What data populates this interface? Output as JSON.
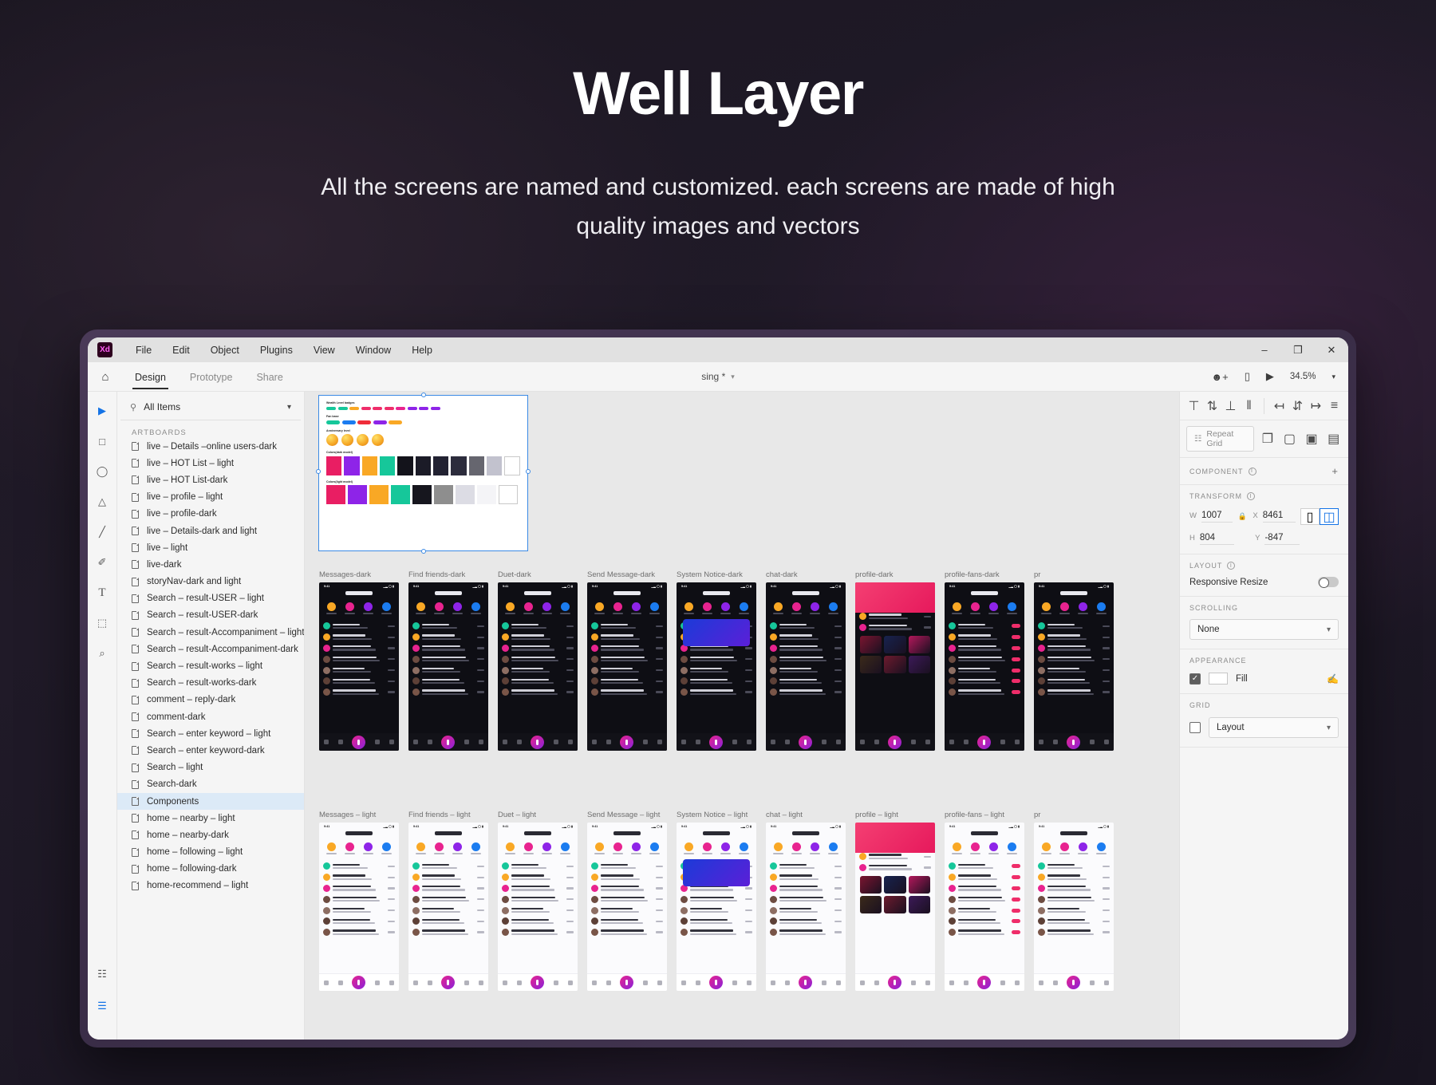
{
  "hero": {
    "title": "Well Layer",
    "subtitle": "All the screens are named and customized. each screens are made of high quality  images and vectors"
  },
  "app": {
    "logo": "Xd",
    "menu": [
      "File",
      "Edit",
      "Object",
      "Plugins",
      "View",
      "Window",
      "Help"
    ],
    "window_controls": [
      "minimize-icon",
      "maximize-icon",
      "close-icon"
    ],
    "tabs": [
      {
        "label": "Design",
        "active": true
      },
      {
        "label": "Prototype",
        "active": false
      },
      {
        "label": "Share",
        "active": false
      }
    ],
    "document_title": "sing *",
    "zoom": "34.5%",
    "toolbar_right_icons": [
      "invite-user-icon",
      "device-preview-icon",
      "play-icon"
    ],
    "home_icon": "home-icon"
  },
  "tools": [
    {
      "name": "select-tool",
      "glyph": "▶",
      "selected": true
    },
    {
      "name": "rectangle-tool",
      "glyph": "□",
      "selected": false
    },
    {
      "name": "ellipse-tool",
      "glyph": "◯",
      "selected": false
    },
    {
      "name": "polygon-tool",
      "glyph": "△",
      "selected": false
    },
    {
      "name": "line-tool",
      "glyph": "╱",
      "selected": false
    },
    {
      "name": "pen-tool",
      "glyph": "✐",
      "selected": false
    },
    {
      "name": "text-tool",
      "glyph": "T",
      "selected": false
    },
    {
      "name": "artboard-tool",
      "glyph": "⬚",
      "selected": false
    },
    {
      "name": "zoom-tool",
      "glyph": "⚲",
      "selected": false
    }
  ],
  "tools_bottom": [
    {
      "name": "assets-panel-icon",
      "glyph": "❐"
    },
    {
      "name": "layers-panel-icon",
      "glyph": "≣"
    }
  ],
  "layers_panel": {
    "search_label": "All Items",
    "search_icon": "search-icon",
    "chevron_icon": "chevron-down-icon",
    "section_title": "ARTBOARDS",
    "items": [
      {
        "label": "live – Details –online users-dark",
        "selected": false
      },
      {
        "label": "live – HOT List – light",
        "selected": false
      },
      {
        "label": "live – HOT List-dark",
        "selected": false
      },
      {
        "label": "live – profile  – light",
        "selected": false
      },
      {
        "label": "live – profile-dark",
        "selected": false
      },
      {
        "label": "live – Details-dark and light",
        "selected": false
      },
      {
        "label": "live – light",
        "selected": false
      },
      {
        "label": "live-dark",
        "selected": false
      },
      {
        "label": "storyNav-dark and light",
        "selected": false
      },
      {
        "label": "Search – result-USER – light",
        "selected": false
      },
      {
        "label": "Search – result-USER-dark",
        "selected": false
      },
      {
        "label": "Search – result-Accompaniment – light",
        "selected": false
      },
      {
        "label": "Search – result-Accompaniment-dark",
        "selected": false
      },
      {
        "label": "Search – result-works  – light",
        "selected": false
      },
      {
        "label": "Search – result-works-dark",
        "selected": false
      },
      {
        "label": "comment – reply-dark",
        "selected": false
      },
      {
        "label": "comment-dark",
        "selected": false
      },
      {
        "label": "Search – enter keyword  – light",
        "selected": false
      },
      {
        "label": "Search – enter keyword-dark",
        "selected": false
      },
      {
        "label": "Search  – light",
        "selected": false
      },
      {
        "label": "Search-dark",
        "selected": false
      },
      {
        "label": "Components",
        "selected": true
      },
      {
        "label": "home – nearby  – light",
        "selected": false
      },
      {
        "label": "home – nearby-dark",
        "selected": false
      },
      {
        "label": "home – following – light",
        "selected": false
      },
      {
        "label": "home – following-dark",
        "selected": false
      },
      {
        "label": "home-recommend – light",
        "selected": false
      }
    ]
  },
  "canvas": {
    "selected_artboard": {
      "sections": [
        {
          "label": "Wealth Level badges"
        },
        {
          "label": "Fan base"
        },
        {
          "label": "Anniversary level"
        },
        {
          "label": "Colors(dark model)"
        },
        {
          "label": "Colors(light model)"
        }
      ],
      "colors_dark": [
        "#e91e63",
        "#8e24e8",
        "#f9a825",
        "#16c79a",
        "#13131b",
        "#1b1b27",
        "#222232",
        "#2c2c3c",
        "#66666f",
        "#c2c2ce",
        "#ffffff"
      ],
      "colors_light": [
        "#e91e63",
        "#8e24e8",
        "#f9a825",
        "#16c79a",
        "#16161e",
        "#8e8e8e",
        "#dcdce4",
        "#f4f4f7",
        "#ffffff"
      ]
    },
    "row_dark": [
      "Messages-dark",
      "Find friends-dark",
      "Duet-dark",
      "Send Message-dark",
      "System Notice-dark",
      "chat-dark",
      "profile-dark",
      "profile-fans-dark",
      "pr"
    ],
    "row_light": [
      "Messages  – light",
      "Find friends – light",
      "Duet  – light",
      "Send Message – light",
      "System Notice  – light",
      "chat – light",
      "profile  – light",
      "profile-fans – light",
      "pr"
    ],
    "accent_pink": "#ef2d6a",
    "accent_purple": "#8b22d8"
  },
  "right_panel": {
    "align_icons": [
      "align-top-icon",
      "align-vertical-center-icon",
      "align-bottom-icon",
      "distribute-horizontal-icon",
      "align-left-icon",
      "align-horizontal-center-icon",
      "align-right-icon",
      "distribute-vertical-icon"
    ],
    "repeat_grid_label": "Repeat Grid",
    "repeat_grid_icon": "grid-icon",
    "boolean_icons": [
      "boolean-add-icon",
      "boolean-subtract-icon",
      "boolean-intersect-icon",
      "boolean-exclude-icon"
    ],
    "component": {
      "title": "COMPONENT",
      "add_icon": "plus-icon"
    },
    "transform": {
      "title": "TRANSFORM",
      "w_label": "W",
      "w_value": "1007",
      "h_label": "H",
      "h_value": "804",
      "x_label": "X",
      "x_value": "8461",
      "y_label": "Y",
      "y_value": "-847",
      "lock_icon": "lock-icon",
      "corner_icons": [
        "square-corner-icon",
        "round-corner-icon"
      ]
    },
    "layout": {
      "title": "LAYOUT",
      "responsive_resize_label": "Responsive Resize",
      "responsive_resize_on": false
    },
    "scrolling": {
      "title": "SCROLLING",
      "value": "None",
      "chevron_icon": "chevron-down-icon"
    },
    "appearance": {
      "title": "APPEARANCE",
      "fill_label": "Fill",
      "fill_checked": true,
      "fill_color": "#ffffff",
      "eyedropper_icon": "eyedropper-icon"
    },
    "grid": {
      "title": "GRID",
      "checked": false,
      "value": "Layout",
      "chevron_icon": "chevron-down-icon"
    }
  }
}
